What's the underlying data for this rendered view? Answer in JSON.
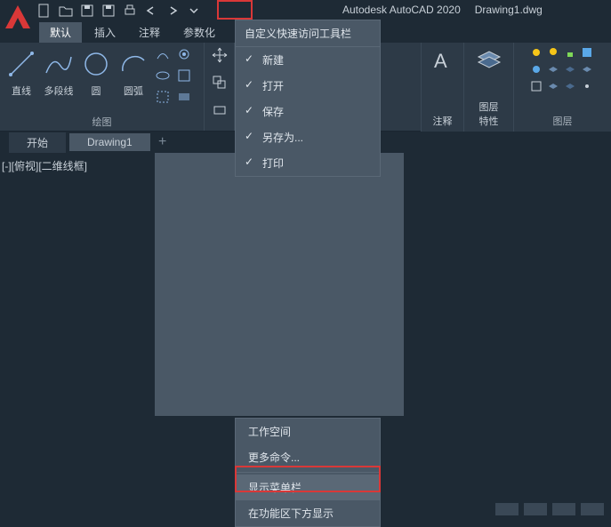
{
  "app": {
    "name": "Autodesk AutoCAD 2020",
    "document": "Drawing1.dwg"
  },
  "tabs": {
    "default": "默认",
    "insert": "插入",
    "annotate": "注释",
    "parametric": "参数化"
  },
  "ribbon": {
    "draw_panel": "绘图",
    "layer_panel": "图层",
    "line": "直线",
    "polyline": "多段线",
    "circle": "圆",
    "arc": "圆弧",
    "annotation_btn": "注释",
    "layer_props": "图层\n特性"
  },
  "file_tabs": {
    "start": "开始",
    "drawing": "Drawing1"
  },
  "viewport": {
    "label": "[-][俯视][二维线框]"
  },
  "qat_menu": {
    "title": "自定义快速访问工具栏",
    "new": "新建",
    "open": "打开",
    "save": "保存",
    "saveas": "另存为...",
    "print": "打印",
    "workspace": "工作空间",
    "more": "更多命令...",
    "show_menubar": "显示菜单栏",
    "below_ribbon": "在功能区下方显示"
  }
}
